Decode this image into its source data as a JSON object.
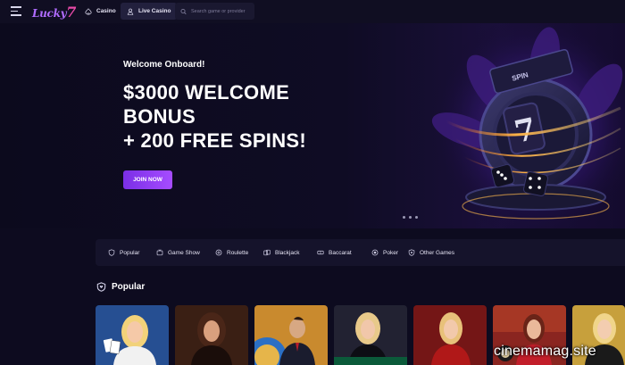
{
  "header": {
    "logo_text": "Lucky",
    "logo_accent": "7",
    "tabs": [
      {
        "label": "Casino",
        "icon": "spade-icon"
      },
      {
        "label": "Live Casino",
        "icon": "dealer-icon"
      }
    ],
    "search": {
      "placeholder": "Search game or provider",
      "icon": "search-icon"
    }
  },
  "hero": {
    "subtitle": "Welcome Onboard!",
    "title_lines": [
      "$3000 WELCOME",
      "BONUS",
      "+ 200 FREE SPINS!"
    ],
    "cta_label": "JOIN NOW",
    "slide_count": 3,
    "active_slide": 1
  },
  "categories": [
    {
      "label": "Popular",
      "icon": "shield-icon"
    },
    {
      "label": "Game Show",
      "icon": "tv-icon"
    },
    {
      "label": "Roulette",
      "icon": "roulette-icon"
    },
    {
      "label": "Blackjack",
      "icon": "cards-icon"
    },
    {
      "label": "Baccarat",
      "icon": "baccarat-icon"
    },
    {
      "label": "Poker",
      "icon": "poker-chip-icon"
    },
    {
      "label": "Other Games",
      "icon": "game-icon"
    }
  ],
  "section": {
    "title": "Popular",
    "icon": "shield-icon"
  },
  "games": [
    {
      "name": "blackjack-dealer-blonde",
      "bg": "#1c3f7a"
    },
    {
      "name": "dealer-brunette",
      "bg": "#3a1f14"
    },
    {
      "name": "dealer-male-wheel",
      "bg": "#c98a2e"
    },
    {
      "name": "dealer-blonde-table",
      "bg": "#2a2a3d"
    },
    {
      "name": "dealer-red-dress",
      "bg": "#5c1212"
    },
    {
      "name": "dealer-roulette",
      "bg": "#8a2520"
    },
    {
      "name": "dealer-gold",
      "bg": "#c7a03c"
    }
  ],
  "watermark": "cinemamag.site",
  "colors": {
    "background": "#0d0b1f",
    "accent": "#a64cff",
    "panel": "#15132b"
  }
}
